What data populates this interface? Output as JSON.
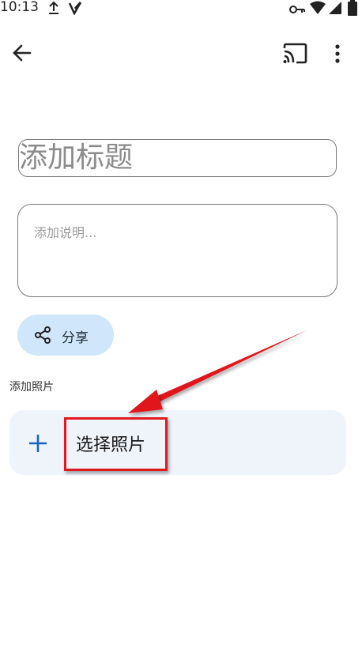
{
  "status_bar": {
    "time": "10:13",
    "icons": [
      "upload-icon",
      "v-notification-icon",
      "vpn-key-icon",
      "wifi-icon",
      "cell-signal-icon",
      "battery-icon"
    ]
  },
  "toolbar": {
    "back_icon": "arrow-back-icon",
    "cast_icon": "cast-icon",
    "more_icon": "more-vert-icon"
  },
  "form": {
    "title_placeholder": "添加标题",
    "description_placeholder": "添加说明..."
  },
  "share": {
    "label": "分享",
    "icon": "share-icon"
  },
  "photos": {
    "section_label": "添加照片",
    "choose_label": "选择照片",
    "add_icon": "plus-icon"
  },
  "annotation": {
    "color": "#e0191f"
  }
}
